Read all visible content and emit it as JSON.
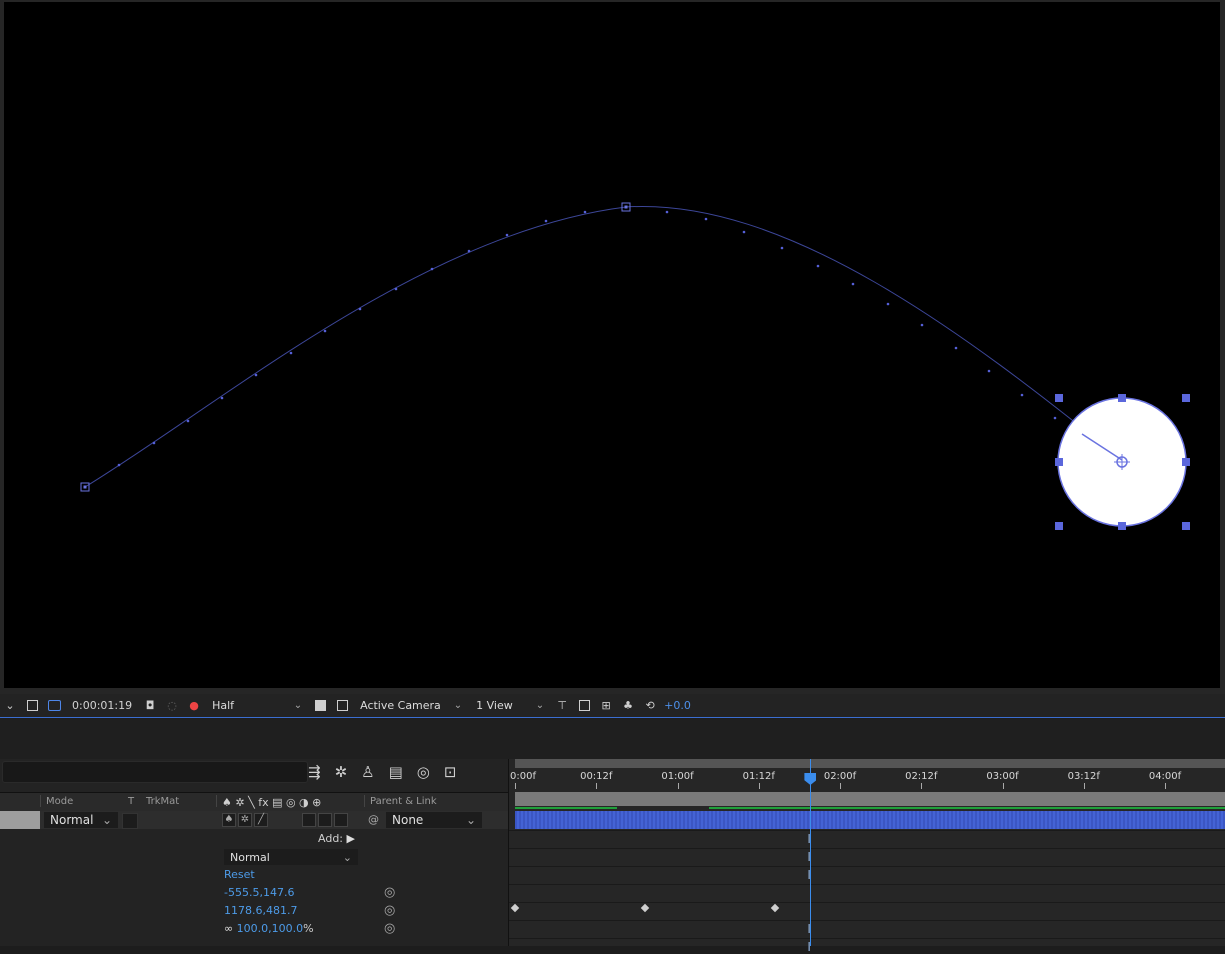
{
  "toolbar": {
    "timecode": "0:00:01:19",
    "resolution": "Half",
    "camera": "Active Camera",
    "views": "1 View",
    "exposure": "+0.0"
  },
  "timeline": {
    "columns": {
      "mode": "Mode",
      "t": "T",
      "trkmat": "TrkMat",
      "parent": "Parent & Link"
    },
    "layer": {
      "mode": "Normal",
      "parent": "None"
    },
    "add_label": "Add:",
    "properties": {
      "blend_mode": "Normal",
      "reset": "Reset",
      "anchor_point": "-555.5,147.6",
      "position": "1178.6,481.7",
      "scale": "100.0,100.0",
      "scale_unit": "%"
    },
    "ruler": {
      "ticks": [
        "0:00f",
        "00:12f",
        "01:00f",
        "01:12f",
        "02:00f",
        "02:12f",
        "03:00f",
        "03:12f",
        "04:00f"
      ],
      "current_frame_position": 0.412
    },
    "keyframes_position_row": [
      0.0,
      0.125,
      0.25
    ]
  },
  "colors": {
    "accent": "#4d8fe8",
    "path": "#4a56c8",
    "layer_bar": "#4463d6",
    "circle_fill": "#ffffff"
  }
}
